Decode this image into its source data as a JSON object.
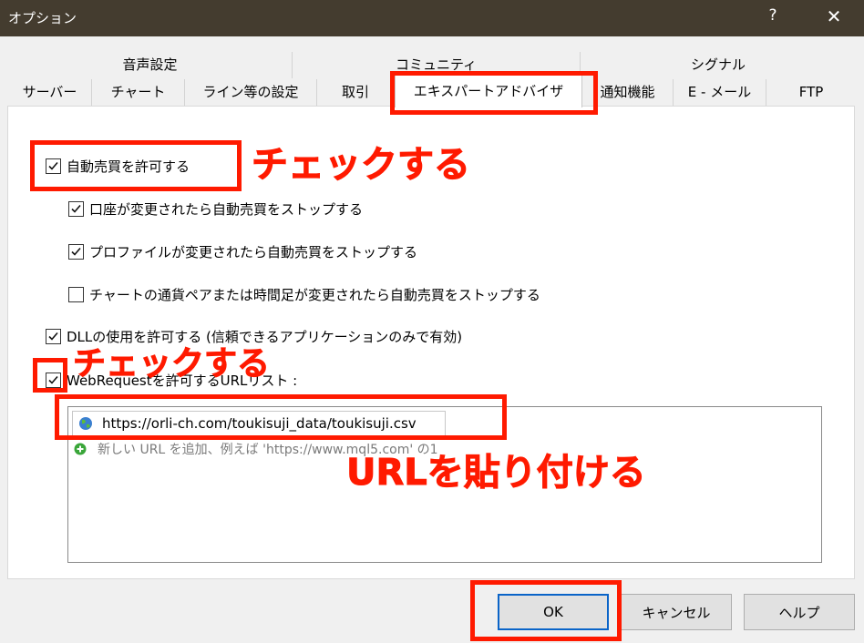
{
  "window": {
    "title": "オプション",
    "help_glyph": "?",
    "close_glyph": "✕"
  },
  "tabs": {
    "row_top": [
      "音声設定",
      "コミュニティ",
      "シグナル"
    ],
    "row_bottom": [
      "サーバー",
      "チャート",
      "ライン等の設定",
      "取引",
      "エキスパートアドバイザ",
      "通知機能",
      "E - メール",
      "FTP"
    ],
    "active": "エキスパートアドバイザ"
  },
  "options": {
    "auto_trading": {
      "label": "自動売買を許可する",
      "checked": true
    },
    "stop_on_account_change": {
      "label": "口座が変更されたら自動売買をストップする",
      "checked": true
    },
    "stop_on_profile_change": {
      "label": "プロファイルが変更されたら自動売買をストップする",
      "checked": true
    },
    "stop_on_chart_change": {
      "label": "チャートの通貨ペアまたは時間足が変更されたら自動売買をストップする",
      "checked": false
    },
    "allow_dll": {
      "label": "DLLの使用を許可する (信頼できるアプリケーションのみで有効)",
      "checked": true
    },
    "allow_webrequest": {
      "label": "WebRequestを許可するURLリスト :",
      "checked": true
    }
  },
  "url_list": {
    "items": [
      "https://orli-ch.com/toukisuji_data/toukisuji.csv"
    ],
    "add_hint": "新しい URL を追加、例えば 'https://www.mql5.com' の1"
  },
  "buttons": {
    "ok": "OK",
    "cancel": "キャンセル",
    "help": "ヘルプ"
  },
  "annotations": {
    "check1": "チェックする",
    "check2": "チェックする",
    "paste": "URLを貼り付ける",
    "color": "#ff1a00"
  }
}
